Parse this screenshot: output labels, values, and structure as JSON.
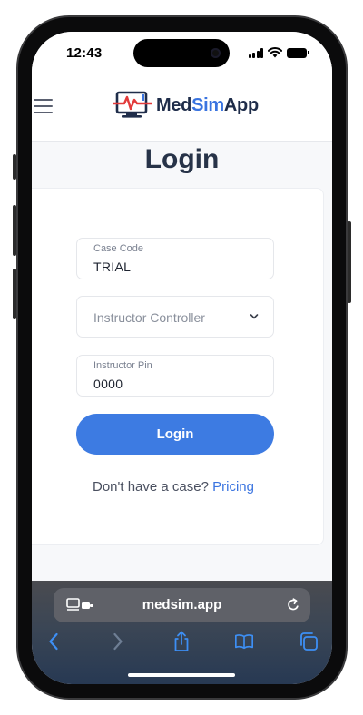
{
  "status_bar": {
    "time": "12:43",
    "icons": [
      "cellular-signal-icon",
      "wifi-icon",
      "battery-icon"
    ]
  },
  "app_header": {
    "logo_text_part1": "Med",
    "logo_text_part2": "Sim",
    "logo_text_part3": "App",
    "menu_icon": "hamburger-menu-icon"
  },
  "page": {
    "title": "Login"
  },
  "form": {
    "case_code": {
      "label": "Case Code",
      "value": "TRIAL"
    },
    "role_select": {
      "value": "Instructor Controller",
      "icon": "chevron-down-icon"
    },
    "instructor_pin": {
      "label": "Instructor Pin",
      "value": "0000"
    },
    "submit_label": "Login",
    "signup_prompt": "Don't have a case?",
    "signup_link": "Pricing"
  },
  "browser": {
    "url": "medsim.app",
    "icons": [
      "reader-mode-icon",
      "reload-icon",
      "back-icon",
      "forward-icon",
      "share-icon",
      "bookmarks-icon",
      "tabs-icon"
    ]
  },
  "colors": {
    "brand_dark": "#1f2d4a",
    "brand_blue": "#3a74e0",
    "brand_red": "#e23a3a",
    "button": "#3d7be2"
  }
}
